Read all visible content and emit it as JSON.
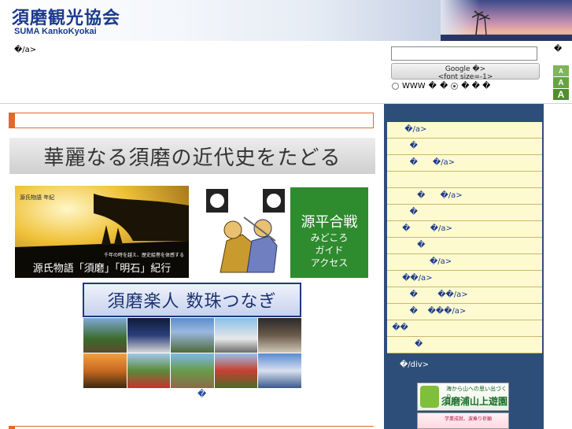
{
  "header": {
    "title": "須磨観光協会",
    "subtitle": "SUMA KankoKyokai"
  },
  "topnav": {
    "text": "�/a>"
  },
  "search": {
    "button_label": "Google  �>",
    "button_sub": "<font size=-1>",
    "options": [
      "WWW",
      "�",
      "�",
      "� � �"
    ],
    "corner": "�"
  },
  "font_size": {
    "labels": [
      "A",
      "A",
      "A"
    ]
  },
  "main": {
    "banner_modern": "華麗なる須磨の近代史をたどる",
    "banner_genji": {
      "caption": "源氏物語「須磨」「明石」紀行",
      "small": "千年の時を越え、歴史絵巻を体感する",
      "logo": "源氏物語 年紀"
    },
    "banner_genpei": {
      "title": "源平合戦",
      "lines": [
        "みどころ",
        "ガイド",
        "アクセス"
      ]
    },
    "banner_rakujin": "須磨楽人 数珠つなぎ",
    "center_glyph": "�"
  },
  "sidebar": {
    "menu": [
      "       �/a>",
      "         �",
      "         �      �/a>",
      "",
      "            �      �/a>",
      "         �",
      "      �        �/a>",
      "            �",
      "                 �/a>",
      "      ��/a>",
      "         �        ��/a>",
      "         �    ���/a>",
      "  ��",
      "           �"
    ],
    "div_text": "�/div>",
    "banner1": {
      "top": "海から山への思い出づくり",
      "main": "須磨浦山上遊園"
    },
    "banner2": "学業成就、波乗り祈願"
  }
}
